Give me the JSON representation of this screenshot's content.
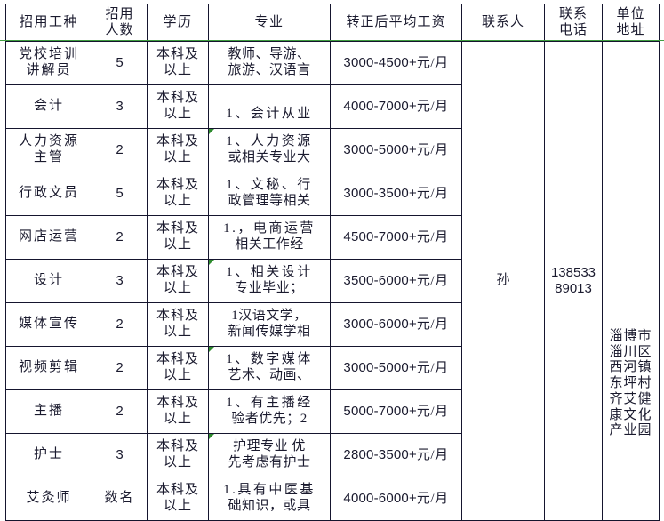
{
  "table": {
    "headers": [
      {
        "key": "job",
        "lines": [
          "招用工种"
        ]
      },
      {
        "key": "num",
        "lines": [
          "招用",
          "人数"
        ]
      },
      {
        "key": "edu",
        "lines": [
          "学历"
        ]
      },
      {
        "key": "major",
        "lines": [
          "专业"
        ]
      },
      {
        "key": "salary",
        "lines": [
          "转正后平均工资"
        ]
      },
      {
        "key": "person",
        "lines": [
          "联系人"
        ]
      },
      {
        "key": "phone",
        "lines": [
          "联系",
          "电话"
        ]
      },
      {
        "key": "addr",
        "lines": [
          "单位",
          "地址"
        ]
      }
    ],
    "contact": {
      "person": "孙",
      "phone_lines": [
        "138533",
        "89013"
      ],
      "address_lines": [
        "淄博市",
        "淄川区",
        "西河镇",
        "东坪村",
        "齐艾健",
        "康文化",
        "产业园"
      ]
    },
    "rows": [
      {
        "job_lines": [
          "党校培训",
          "讲解员"
        ],
        "count": "5",
        "edu_lines": [
          "本科及",
          "以上"
        ],
        "major_lines": [
          "教师、导游、",
          "旅游、汉语言"
        ],
        "major_marker": false,
        "salary_amount": "3000-4500+",
        "salary_unit": "元/月"
      },
      {
        "job_lines": [
          "会计"
        ],
        "count": "3",
        "edu_lines": [
          "本科及",
          "以上"
        ],
        "major_lines": [
          "",
          "1、会计从业"
        ],
        "major_marker": false,
        "salary_amount": "4000-7000+",
        "salary_unit": "元/月"
      },
      {
        "job_lines": [
          "人力资源",
          "主管"
        ],
        "count": "2",
        "edu_lines": [
          "本科及",
          "以上"
        ],
        "major_lines": [
          "1、人力资源",
          "或相关专业大"
        ],
        "major_marker": true,
        "salary_amount": "3000-5000+",
        "salary_unit": "元/月"
      },
      {
        "job_lines": [
          "行政文员"
        ],
        "count": "5",
        "edu_lines": [
          "本科及",
          "以上"
        ],
        "major_lines": [
          "1、文秘、行",
          "政管理等相关"
        ],
        "major_marker": false,
        "salary_amount": "3000-3500+",
        "salary_unit": "元/月"
      },
      {
        "job_lines": [
          "网店运营"
        ],
        "count": "2",
        "edu_lines": [
          "本科及",
          "以上"
        ],
        "major_lines": [
          "1.，电商运营",
          "相关工作经"
        ],
        "major_marker": false,
        "salary_amount": "4500-7000+",
        "salary_unit": "元/月"
      },
      {
        "job_lines": [
          "设计"
        ],
        "count": "3",
        "edu_lines": [
          "本科及",
          "以上"
        ],
        "major_lines": [
          "1、相关设计",
          "专业毕业；"
        ],
        "major_marker": true,
        "salary_amount": "3500-6000+",
        "salary_unit": "元/月"
      },
      {
        "job_lines": [
          "媒体宣传"
        ],
        "count": "2",
        "edu_lines": [
          "本科及",
          "以上"
        ],
        "major_lines": [
          "1汉语文学，",
          "新闻传媒学相"
        ],
        "major_marker": false,
        "salary_amount": "3000-6000+",
        "salary_unit": "元/月"
      },
      {
        "job_lines": [
          "视频剪辑"
        ],
        "count": "2",
        "edu_lines": [
          "本科及",
          "以上"
        ],
        "major_lines": [
          "1、数字媒体",
          "艺术、动画、"
        ],
        "major_marker": true,
        "salary_amount": "3000-5000+",
        "salary_unit": "元/月"
      },
      {
        "job_lines": [
          "主播"
        ],
        "count": "2",
        "edu_lines": [
          "本科及",
          "以上"
        ],
        "major_lines": [
          "1、有主播经",
          "验者优先；2"
        ],
        "major_marker": false,
        "salary_amount": "5000-7000+",
        "salary_unit": "元/月"
      },
      {
        "job_lines": [
          "护士"
        ],
        "count": "3",
        "edu_lines": [
          "本科及",
          "以上"
        ],
        "major_lines": [
          "护理专业 优",
          "先考虑有护士"
        ],
        "major_marker": true,
        "salary_amount": "2800-3500+",
        "salary_unit": "元/月"
      },
      {
        "job_lines": [
          "艾灸师"
        ],
        "count": "数名",
        "count_cjk": true,
        "edu_lines": [
          "本科及",
          "以上"
        ],
        "major_lines": [
          "1.具有中医基",
          "础知识，或具"
        ],
        "major_marker": false,
        "salary_amount": "4000-6000+",
        "salary_unit": "元/月"
      }
    ]
  },
  "colors": {
    "grid_line": "#15152e",
    "header_rule": "#3f9d3f",
    "marker": "#2e8b2e",
    "text": "#1a1a2e"
  }
}
